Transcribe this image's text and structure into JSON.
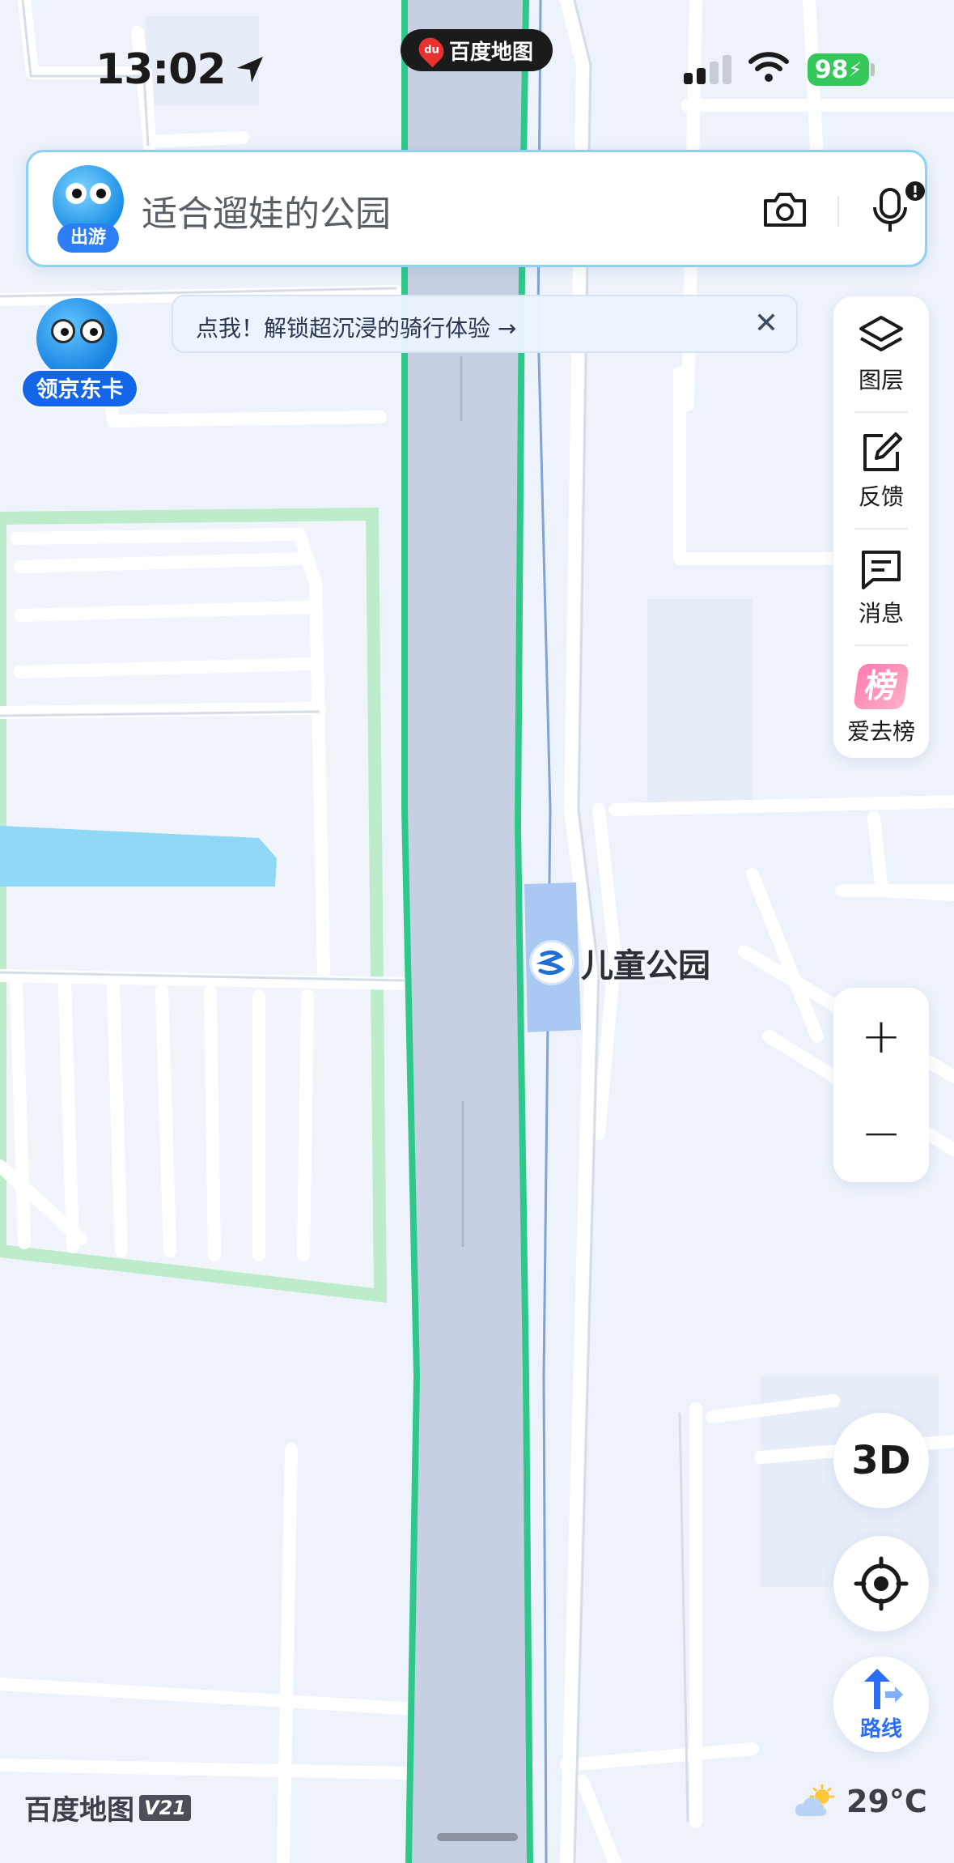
{
  "status_bar": {
    "time": "13:02",
    "battery": "98"
  },
  "app_pill": {
    "icon_text": "du",
    "label": "百度地图"
  },
  "search": {
    "avatar_badge": "出游",
    "query": "适合遛娃的公园"
  },
  "promo": {
    "badge": "领京东卡"
  },
  "banner": {
    "text": "点我！解锁超沉浸的骑行体验 →"
  },
  "toolbar": {
    "items": [
      {
        "label": "图层",
        "icon": "layers-icon"
      },
      {
        "label": "反馈",
        "icon": "edit-icon"
      },
      {
        "label": "消息",
        "icon": "message-icon"
      },
      {
        "label": "爱去榜",
        "icon": "rank-icon",
        "glyph": "榜"
      }
    ]
  },
  "zoom": {
    "in": "+",
    "out": "−"
  },
  "buttons": {
    "view_3d": "3D",
    "route": "路线"
  },
  "map": {
    "poi_label": "儿童公园",
    "colors": {
      "background": "#eef3fb",
      "expressway": "#c6d0e2",
      "green_border": "#2ec98a",
      "park": "#bdeccb",
      "water": "#8fd8f6"
    }
  },
  "footer": {
    "brand": "百度地图",
    "version": "V21",
    "temperature": "29°C"
  }
}
